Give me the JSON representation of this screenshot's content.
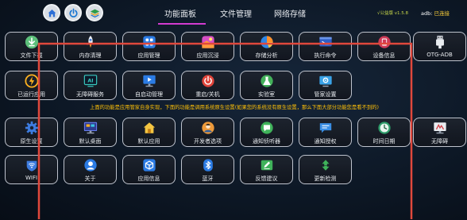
{
  "topbar": {
    "tabs": [
      {
        "label": "功能面板",
        "active": true
      },
      {
        "label": "文件管理",
        "active": false
      },
      {
        "label": "网络存储",
        "active": false
      }
    ],
    "version": "√公益版 v1.5.8",
    "adb_label": "adb:",
    "adb_status": "已连接",
    "quick_buttons": [
      "home-icon",
      "power-icon",
      "layers-icon"
    ]
  },
  "notice": "上面的功能是应用管家自身实现，下面的功能是调用系统原生设置(如果您的系统没有原生设置，那么下面大部分功能您是看不到的)",
  "tiles": [
    {
      "label": "文件下载",
      "icon": "download-icon"
    },
    {
      "label": "内存清理",
      "icon": "rocket-icon"
    },
    {
      "label": "应用管理",
      "icon": "app-manager-icon"
    },
    {
      "label": "应用沉浸",
      "icon": "immersive-icon"
    },
    {
      "label": "存储分析",
      "icon": "pie-chart-icon"
    },
    {
      "label": "执行命令",
      "icon": "terminal-icon"
    },
    {
      "label": "设备信息",
      "icon": "device-info-icon"
    },
    {
      "label": "OTG-ADB",
      "icon": "usb-icon"
    },
    {
      "label": "已运行应用",
      "icon": "running-apps-icon"
    },
    {
      "label": "无障碍服务",
      "icon": "ai-icon"
    },
    {
      "label": "自启动管理",
      "icon": "autostart-icon"
    },
    {
      "label": "重启/关机",
      "icon": "reboot-icon"
    },
    {
      "label": "实验室",
      "icon": "lab-icon"
    },
    {
      "label": "管家设置",
      "icon": "settings-display-icon"
    },
    {
      "label": "原生设置",
      "icon": "gear-icon"
    },
    {
      "label": "默认桌面",
      "icon": "desktop-icon"
    },
    {
      "label": "默认应用",
      "icon": "home-app-icon"
    },
    {
      "label": "开发者选项",
      "icon": "developer-icon"
    },
    {
      "label": "通知侦听器",
      "icon": "notification-listener-icon"
    },
    {
      "label": "通知授权",
      "icon": "notification-auth-icon"
    },
    {
      "label": "时间日期",
      "icon": "clock-icon"
    },
    {
      "label": "无障碍",
      "icon": "accessibility-icon"
    },
    {
      "label": "WIFI",
      "icon": "wifi-icon"
    },
    {
      "label": "关于",
      "icon": "about-icon"
    },
    {
      "label": "应用信息",
      "icon": "app-info-icon"
    },
    {
      "label": "蓝牙",
      "icon": "bluetooth-icon"
    },
    {
      "label": "反馈建议",
      "icon": "feedback-icon"
    },
    {
      "label": "更新检测",
      "icon": "update-icon"
    }
  ],
  "colors": {
    "tab_active_underline": "#d23bd0",
    "notice": "#ffc107",
    "adb_status": "#ffd23a",
    "version": "#c8d84a",
    "highlight_box": "#e0483c"
  }
}
